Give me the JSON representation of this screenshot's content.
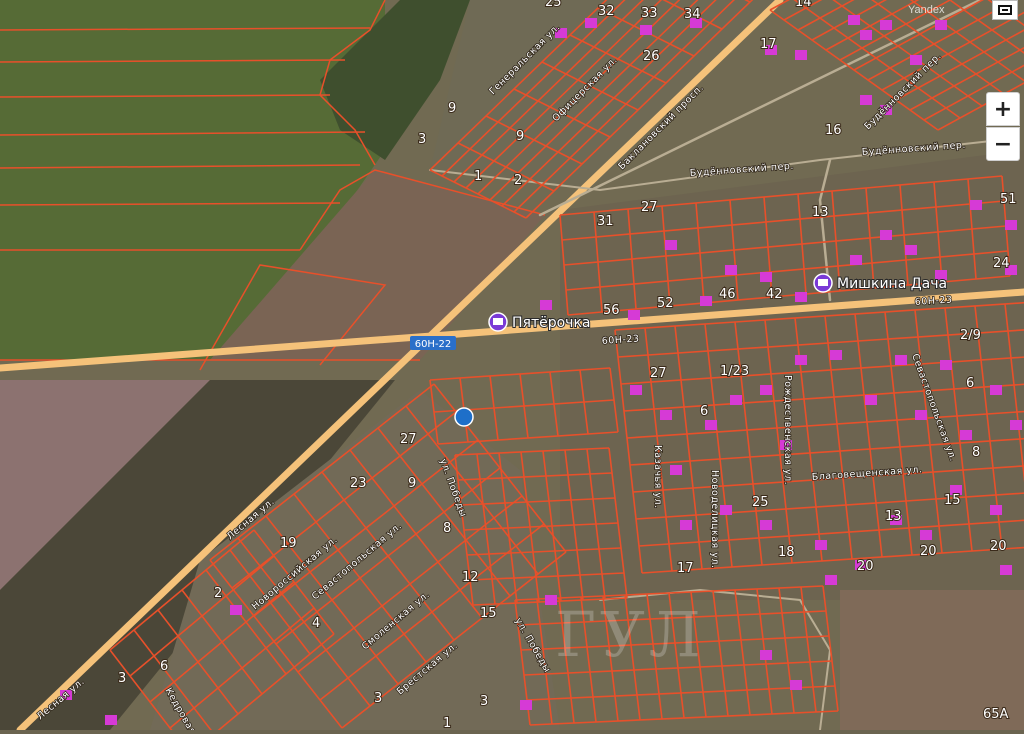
{
  "controls": {
    "zoom_in": "+",
    "zoom_out": "−"
  },
  "attribution": "Yandex",
  "watermark": "ГУЛ",
  "pois": [
    {
      "name": "Пятёрочка"
    },
    {
      "name": "Мишкина Дача"
    }
  ],
  "road_shields": [
    "60Н-22",
    "60Н-23",
    "60Н-23"
  ],
  "streets": [
    "Генеральская ул.",
    "Офицерская ул.",
    "Баклановский просп.",
    "Будённовский пер.",
    "Будённовский пер.",
    "Будённовский пер.",
    "ул. Победы",
    "Лесная ул.",
    "Севастопольская ул.",
    "Новороссийская ул.",
    "Смоленская ул.",
    "Брестская ул.",
    "ул. Победы",
    "Лесная ул.",
    "Кедровая ул.",
    "Рождественская ул.",
    "Новоделицкая ул.",
    "Казачья ул.",
    "Благовещенская ул.",
    "Севастопольская ул."
  ],
  "house_numbers": [
    {
      "t": "25"
    },
    {
      "t": "32"
    },
    {
      "t": "33"
    },
    {
      "t": "34"
    },
    {
      "t": "14"
    },
    {
      "t": "17"
    },
    {
      "t": "26"
    },
    {
      "t": "9"
    },
    {
      "t": "9"
    },
    {
      "t": "3"
    },
    {
      "t": "1"
    },
    {
      "t": "2"
    },
    {
      "t": "16"
    },
    {
      "t": "31"
    },
    {
      "t": "27"
    },
    {
      "t": "13"
    },
    {
      "t": "56"
    },
    {
      "t": "52"
    },
    {
      "t": "46"
    },
    {
      "t": "42"
    },
    {
      "t": "51"
    },
    {
      "t": "24"
    },
    {
      "t": "2/9"
    },
    {
      "t": "6"
    },
    {
      "t": "27"
    },
    {
      "t": "1/23"
    },
    {
      "t": "6"
    },
    {
      "t": "8"
    },
    {
      "t": "25"
    },
    {
      "t": "15"
    },
    {
      "t": "18"
    },
    {
      "t": "17"
    },
    {
      "t": "20"
    },
    {
      "t": "13"
    },
    {
      "t": "20"
    },
    {
      "t": "20"
    },
    {
      "t": "27"
    },
    {
      "t": "23"
    },
    {
      "t": "9"
    },
    {
      "t": "8"
    },
    {
      "t": "19"
    },
    {
      "t": "12"
    },
    {
      "t": "2"
    },
    {
      "t": "4"
    },
    {
      "t": "15"
    },
    {
      "t": "6"
    },
    {
      "t": "3"
    },
    {
      "t": "3"
    },
    {
      "t": "3"
    },
    {
      "t": "1"
    },
    {
      "t": "65А"
    }
  ],
  "colors": {
    "parcel": "#e8502a",
    "road": "#f5c27a",
    "marker": "#1e6fc9",
    "building": "#d63ad6"
  }
}
